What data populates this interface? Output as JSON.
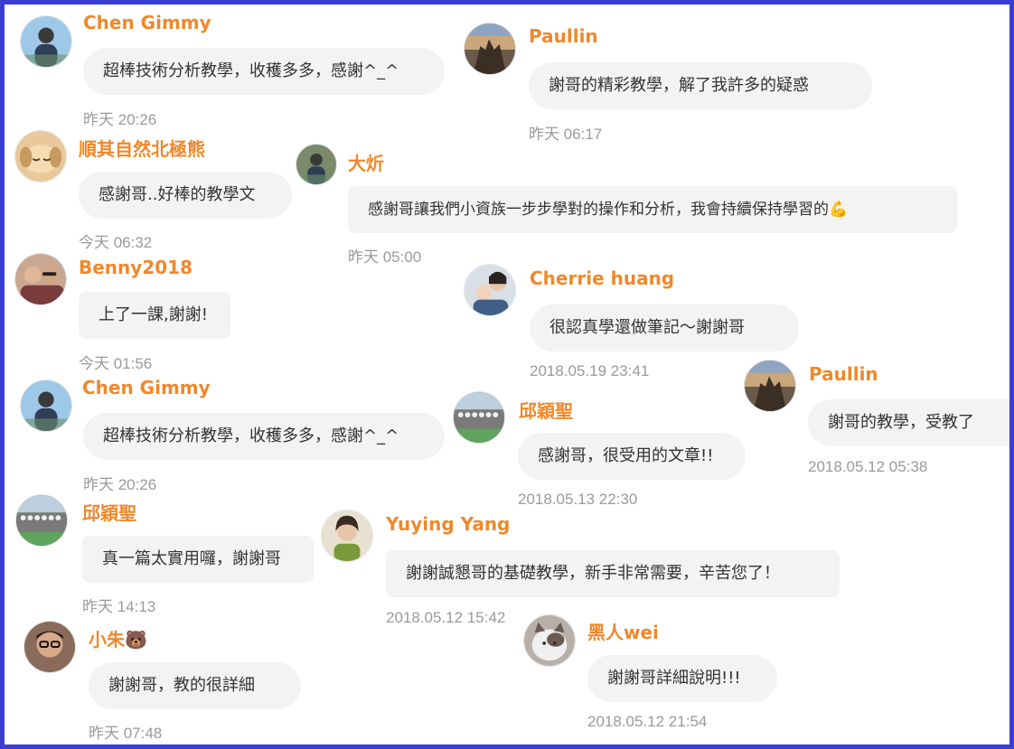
{
  "messages": [
    {
      "name": "Chen Gimmy",
      "text": "超棒技術分析教學，收穫多多，感謝^_^",
      "time": "昨天 20:26",
      "avatar": "person-avatar-icon",
      "bg": "#9ec8e8"
    },
    {
      "name": "Paullin",
      "text": "謝哥的精彩教學，解了我許多的疑惑",
      "time": "昨天 06:17",
      "avatar": "castle-photo-avatar-icon",
      "bg": "#6a5a4a"
    },
    {
      "name": "順其自然北極熊",
      "text": "感謝哥..好棒的教學文",
      "time": "今天 06:32",
      "avatar": "puppy-avatar-icon",
      "bg": "#e9c99c"
    },
    {
      "name": "大炘",
      "text": "感謝哥讓我們小資族一步步學對的操作和分析，我會持續保持學習的💪",
      "time": "昨天 05:00",
      "avatar": "person-avatar-icon",
      "bg": "#7a8a6a"
    },
    {
      "name": "Benny2018",
      "text": "上了一課,謝謝!",
      "time": "今天 01:56",
      "avatar": "couple-avatar-icon",
      "bg": "#c8a890"
    },
    {
      "name": "Cherrie huang",
      "text": "很認真學還做筆記～謝謝哥",
      "time": "2018.05.19 23:41",
      "avatar": "mother-child-avatar-icon",
      "bg": "#d9dfe6"
    },
    {
      "name": "Paullin",
      "text": "謝哥的教學，受教了",
      "time": "2018.05.12 05:38",
      "avatar": "castle-photo-avatar-icon",
      "bg": "#6a5a4a"
    },
    {
      "name": "Chen Gimmy",
      "text": "超棒技術分析教學，收穫多多，感謝^_^",
      "time": "昨天 20:26",
      "avatar": "person-avatar-icon",
      "bg": "#9ec8e8"
    },
    {
      "name": "邱穎聖",
      "text": "感謝哥，很受用的文章!!",
      "time": "2018.05.13 22:30",
      "avatar": "group-photo-avatar-icon",
      "bg": "#5e8a5e"
    },
    {
      "name": "邱穎聖",
      "text": "真一篇太實用囉，謝謝哥",
      "time": "昨天 14:13",
      "avatar": "group-photo-avatar-icon",
      "bg": "#5e8a5e"
    },
    {
      "name": "Yuying Yang",
      "text": "謝謝誠懇哥的基礎教學，新手非常需要，辛苦您了！",
      "time": "2018.05.12 15:42",
      "avatar": "woman-avatar-icon",
      "bg": "#e8e0d0"
    },
    {
      "name": "小朱🐻",
      "text": "謝謝哥，教的很詳細",
      "time": "昨天 07:48",
      "avatar": "man-glasses-avatar-icon",
      "bg": "#8a6a5a"
    },
    {
      "name": "黑人wei",
      "text": "謝謝哥詳細說明!!!",
      "time": "2018.05.12 21:54",
      "avatar": "cat-avatar-icon",
      "bg": "#b8b0a8"
    }
  ],
  "colors": {
    "border": "#3a3fd4",
    "name": "#f0882a",
    "bubble": "#f3f3f3",
    "time": "#9a9a9a"
  }
}
